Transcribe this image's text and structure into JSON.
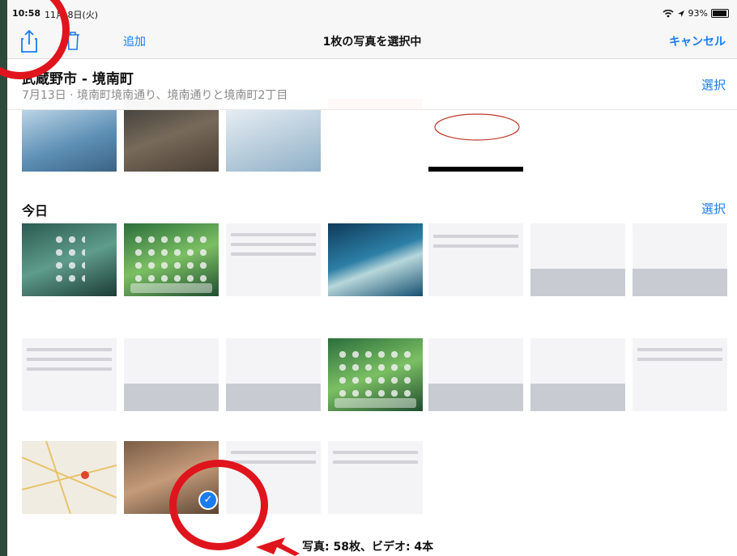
{
  "status_bar": {
    "time": "10:58",
    "date": "11月 8日(火)",
    "battery_percent_text": "93%",
    "battery_level": 0.93
  },
  "toolbar": {
    "share_icon": "share-icon",
    "trash_icon": "trash-icon",
    "add_label": "追加",
    "title": "1枚の写真を選択中",
    "cancel_label": "キャンセル"
  },
  "section_location": {
    "title": "武蔵野市 - 境南町",
    "subtitle": "7月13日 · 境南町境南通り、境南通りと境南町2丁目",
    "select_label": "選択"
  },
  "section_today": {
    "title": "今日",
    "select_label": "選択"
  },
  "footer": {
    "count_text": "写真: 58枚、ビデオ: 4本"
  },
  "colors": {
    "accent": "#1a7cf0",
    "annotation_red": "#e0141c"
  }
}
